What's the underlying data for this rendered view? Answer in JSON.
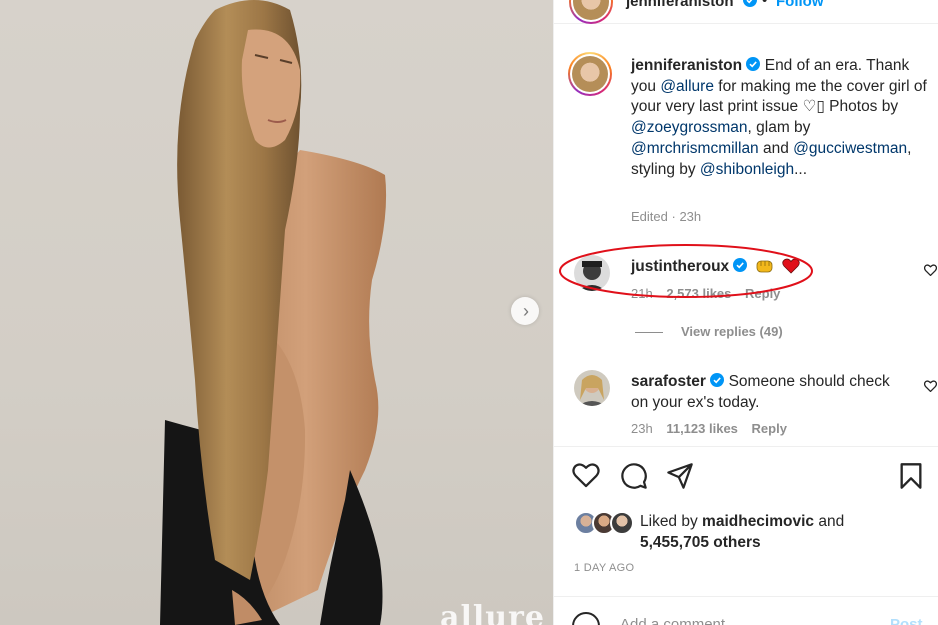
{
  "post": {
    "username": "jenniferaniston",
    "follow_label": "Follow",
    "more_label": "•••",
    "watermark": "allure"
  },
  "caption": {
    "username": "jenniferaniston",
    "text_1": " End of an era. Thank you ",
    "mention_allure": "@allure",
    "text_2": " for making me the cover girl of your very last print issue ",
    "emoji": "♡▯",
    "text_3": " Photos by ",
    "mention_zoey": "@zoeygrossman",
    "text_4": ", glam by ",
    "mention_chris": "@mrchrismcmillan",
    "text_5": " and ",
    "mention_gucci": "@gucciwestman",
    "text_6": ", styling by ",
    "mention_shibon": "@shibonleigh",
    "text_7": "...",
    "edited": "Edited",
    "time": "23h"
  },
  "comments": [
    {
      "username": "justintheroux",
      "text": "",
      "time": "21h",
      "likes": "2,573 likes",
      "reply": "Reply"
    },
    {
      "username": "sarafoster",
      "text": "Someone should check on your ex's today.",
      "time": "23h",
      "likes": "11,123 likes",
      "reply": "Reply"
    }
  ],
  "view_replies": "View replies (49)",
  "likes": {
    "prefix": "Liked by ",
    "user": "maidhecimovic",
    "suffix": " and",
    "count": "5,455,705 others"
  },
  "date": "1 DAY AGO",
  "add_comment": {
    "placeholder": "Add a comment...",
    "post_label": "Post"
  },
  "colors": {
    "link": "#00376b",
    "verified": "#0095f6",
    "highlight_circle": "#e0101a"
  }
}
